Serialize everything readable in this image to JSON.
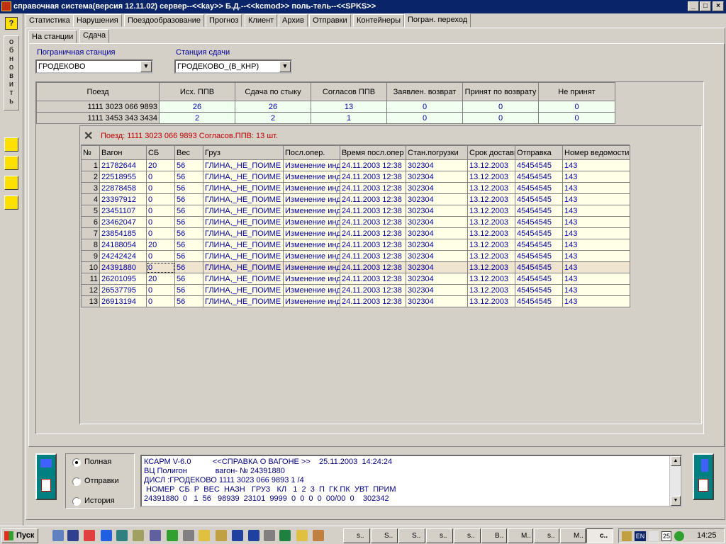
{
  "window": {
    "title": "справочная система(версия 12.11.02) сервер--<<kay>> Б.Д.--<<kcmod>> поль-тель--<<SPKS>>",
    "min": "_",
    "max": "□",
    "close": "×"
  },
  "sidebar": {
    "help": "?",
    "refresh": "обновить"
  },
  "top_tabs": [
    "Статистика",
    "Нарушения",
    "Поездообразование",
    "Прогноз",
    "Клиент",
    "Архив",
    "Отправки",
    "Контейнеры",
    "Погран. переход"
  ],
  "sub_tabs": [
    "На станции",
    "Сдача"
  ],
  "filters": {
    "border_station_label": "Пограничная станция",
    "border_station_value": "ГРОДЕКОВО",
    "handover_station_label": "Станция сдачи",
    "handover_station_value": "ГРОДЕКОВО_(В_КНР)"
  },
  "summary": {
    "headers": [
      "Поезд",
      "Исх. ППВ",
      "Сдача по стыку",
      "Согласов ППВ",
      "Заявлен. возврат",
      "Принят по возврату",
      "Не принят"
    ],
    "rows": [
      [
        "1111 3023 066 9893",
        "26",
        "26",
        "13",
        "0",
        "0",
        "0"
      ],
      [
        "1111 3453 343 3434",
        "2",
        "2",
        "1",
        "0",
        "0",
        "0"
      ]
    ]
  },
  "detail": {
    "info": "Поезд:  1111 3023 066 9893    Согласов.ППВ: 13 шт.",
    "headers": [
      "№",
      "Вагон",
      "СБ",
      "Вес",
      "Груз",
      "Посл.опер.",
      "Время посл.опер",
      "Стан.погрузки",
      "Срок доставки",
      "Отправка",
      "Номер ведомости"
    ],
    "rows": [
      [
        "1",
        "21782644",
        "20",
        "56",
        "ГЛИНА,_НЕ_ПОИМЕ",
        "Изменение инд",
        "24.11.2003  12:38",
        "302304",
        "13.12.2003",
        "45454545",
        "143"
      ],
      [
        "2",
        "22518955",
        "0",
        "56",
        "ГЛИНА,_НЕ_ПОИМЕ",
        "Изменение инд",
        "24.11.2003  12:38",
        "302304",
        "13.12.2003",
        "45454545",
        "143"
      ],
      [
        "3",
        "22878458",
        "0",
        "56",
        "ГЛИНА,_НЕ_ПОИМЕ",
        "Изменение инд",
        "24.11.2003  12:38",
        "302304",
        "13.12.2003",
        "45454545",
        "143"
      ],
      [
        "4",
        "23397912",
        "0",
        "56",
        "ГЛИНА,_НЕ_ПОИМЕ",
        "Изменение инд",
        "24.11.2003  12:38",
        "302304",
        "13.12.2003",
        "45454545",
        "143"
      ],
      [
        "5",
        "23451107",
        "0",
        "56",
        "ГЛИНА,_НЕ_ПОИМЕ",
        "Изменение инд",
        "24.11.2003  12:38",
        "302304",
        "13.12.2003",
        "45454545",
        "143"
      ],
      [
        "6",
        "23462047",
        "0",
        "56",
        "ГЛИНА,_НЕ_ПОИМЕ",
        "Изменение инд",
        "24.11.2003  12:38",
        "302304",
        "13.12.2003",
        "45454545",
        "143"
      ],
      [
        "7",
        "23854185",
        "0",
        "56",
        "ГЛИНА,_НЕ_ПОИМЕ",
        "Изменение инд",
        "24.11.2003  12:38",
        "302304",
        "13.12.2003",
        "45454545",
        "143"
      ],
      [
        "8",
        "24188054",
        "20",
        "56",
        "ГЛИНА,_НЕ_ПОИМЕ",
        "Изменение инд",
        "24.11.2003  12:38",
        "302304",
        "13.12.2003",
        "45454545",
        "143"
      ],
      [
        "9",
        "24242424",
        "0",
        "56",
        "ГЛИНА,_НЕ_ПОИМЕ",
        "Изменение инд",
        "24.11.2003  12:38",
        "302304",
        "13.12.2003",
        "45454545",
        "143"
      ],
      [
        "10",
        "24391880",
        "0",
        "56",
        "ГЛИНА,_НЕ_ПОИМЕ",
        "Изменение инд",
        "24.11.2003  12:38",
        "302304",
        "13.12.2003",
        "45454545",
        "143"
      ],
      [
        "11",
        "26201095",
        "20",
        "56",
        "ГЛИНА,_НЕ_ПОИМЕ",
        "Изменение инд",
        "24.11.2003  12:38",
        "302304",
        "13.12.2003",
        "45454545",
        "143"
      ],
      [
        "12",
        "26537795",
        "0",
        "56",
        "ГЛИНА,_НЕ_ПОИМЕ",
        "Изменение инд",
        "24.11.2003  12:38",
        "302304",
        "13.12.2003",
        "45454545",
        "143"
      ],
      [
        "13",
        "26913194",
        "0",
        "56",
        "ГЛИНА,_НЕ_ПОИМЕ",
        "Изменение инд",
        "24.11.2003  12:38",
        "302304",
        "13.12.2003",
        "45454545",
        "143"
      ]
    ],
    "selected_row": 10
  },
  "bottom": {
    "radios": [
      "Полная",
      "Отправки",
      "История"
    ],
    "selected": "Полная",
    "memo": "КСАРМ V-6.0          <<СПРАВКА О ВАГОНЕ >>    25.11.2003  14:24:24\nВЦ Полигон             вагон- № 24391880\nДИСЛ :ГРОДЕКОВО 1111 3023 066 9893 1 /4\n НОМЕР  СБ  Р  ВЕС  НАЗН   ГРУЗ   КЛ   1  2  3  П  ГК ПК  УВТ  ПРИМ\n24391880  0   1  56   98939  23101  9999  0  0  0  0  00/00  0    302342"
  },
  "taskbar": {
    "start": "Пуск",
    "tasks": [
      "s..",
      "S..",
      "S..",
      "s..",
      "s..",
      "B..",
      "M..",
      "s..",
      "M..",
      "c.."
    ],
    "lang": "EN",
    "date_icon": "25",
    "clock": "14:25"
  },
  "colors": {
    "title_bg": "#0a246a",
    "cell_text": "#0000a0",
    "info_text": "#c00000",
    "side_yellow": "#ffe000"
  }
}
